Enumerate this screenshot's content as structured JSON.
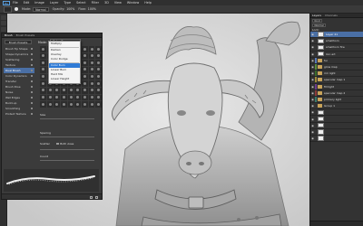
{
  "menubar": {
    "logo": "Ps",
    "items": [
      "File",
      "Edit",
      "Image",
      "Layer",
      "Type",
      "Select",
      "Filter",
      "3D",
      "View",
      "Window",
      "Help"
    ]
  },
  "options": {
    "mode_label": "Mode:",
    "mode_value": "Normal",
    "opacity_label": "Opacity:",
    "opacity_value": "100%",
    "flow_label": "Flow:",
    "flow_value": "100%"
  },
  "brush_panel": {
    "tabs": [
      "Brush",
      "Brush Presets"
    ],
    "presets_button": "Brush Presets",
    "side_items": [
      {
        "label": "Brush Tip Shape",
        "state": "plain"
      },
      {
        "label": "Shape Dynamics",
        "state": "plain"
      },
      {
        "label": "Scattering",
        "state": "plain"
      },
      {
        "label": "Texture",
        "state": "plain"
      },
      {
        "label": "Dual Brush",
        "state": "on"
      },
      {
        "label": "Color Dynamics",
        "state": "plain"
      },
      {
        "label": "Transfer",
        "state": "plain"
      },
      {
        "label": "Brush Pose",
        "state": "plain"
      },
      {
        "label": "Noise",
        "state": "plain"
      },
      {
        "label": "Wet Edges",
        "state": "plain"
      },
      {
        "label": "Build-up",
        "state": "plain"
      },
      {
        "label": "Smoothing",
        "state": "plain"
      },
      {
        "label": "Protect Texture",
        "state": "plain"
      }
    ],
    "mode_label": "Mode:",
    "mode_value": "Color Burn",
    "size_label": "Size",
    "spacing_label": "Spacing",
    "scatter_label": "Scatter",
    "both_axes_label": "Both Axes",
    "count_label": "Count"
  },
  "blend_dropdown": {
    "items": [
      "Multiply",
      "Darken",
      "Overlay",
      "Color Dodge",
      "Color Burn",
      "Linear Burn",
      "Hard Mix",
      "Linear Height"
    ],
    "selected": "Color Burn"
  },
  "layers_panel": {
    "tabs": [
      "Layers",
      "Channels"
    ],
    "kind_label": "Kind",
    "blend_value": "Normal",
    "lock_label": "Lock:",
    "layers": [
      {
        "name": "Layer 21",
        "active": true,
        "type": "layer",
        "color": ""
      },
      {
        "name": "smallhorn",
        "active": false,
        "type": "layer",
        "color": ""
      },
      {
        "name": "smallhorn fire",
        "active": false,
        "type": "layer",
        "color": ""
      },
      {
        "name": "lion art",
        "active": false,
        "type": "layer",
        "color": ""
      },
      {
        "name": "fur",
        "active": false,
        "type": "folder",
        "color": "#5a7ab8"
      },
      {
        "name": "glow map",
        "active": false,
        "type": "folder",
        "color": "#5a8a3a"
      },
      {
        "name": "rim light",
        "active": false,
        "type": "folder",
        "color": "#3a6a2a"
      },
      {
        "name": "specular map 1",
        "active": false,
        "type": "folder",
        "color": "#a08a3a"
      },
      {
        "name": "fill light",
        "active": false,
        "type": "folder",
        "color": "#6a3a8a"
      },
      {
        "name": "specular map 2",
        "active": false,
        "type": "folder",
        "color": "#8a3a3a"
      },
      {
        "name": "primary light",
        "active": false,
        "type": "folder",
        "color": "#3a7a6a"
      },
      {
        "name": "Group 1",
        "active": false,
        "type": "folder",
        "color": ""
      },
      {
        "name": "",
        "active": false,
        "type": "layer",
        "color": ""
      },
      {
        "name": "",
        "active": false,
        "type": "layer",
        "color": ""
      },
      {
        "name": "",
        "active": false,
        "type": "layer",
        "color": ""
      },
      {
        "name": "",
        "active": false,
        "type": "layer",
        "color": ""
      },
      {
        "name": "",
        "active": false,
        "type": "layer",
        "color": ""
      }
    ]
  },
  "colors": {
    "accent": "#4a6fa5",
    "dropdown_highlight": "#2f7bd6"
  }
}
